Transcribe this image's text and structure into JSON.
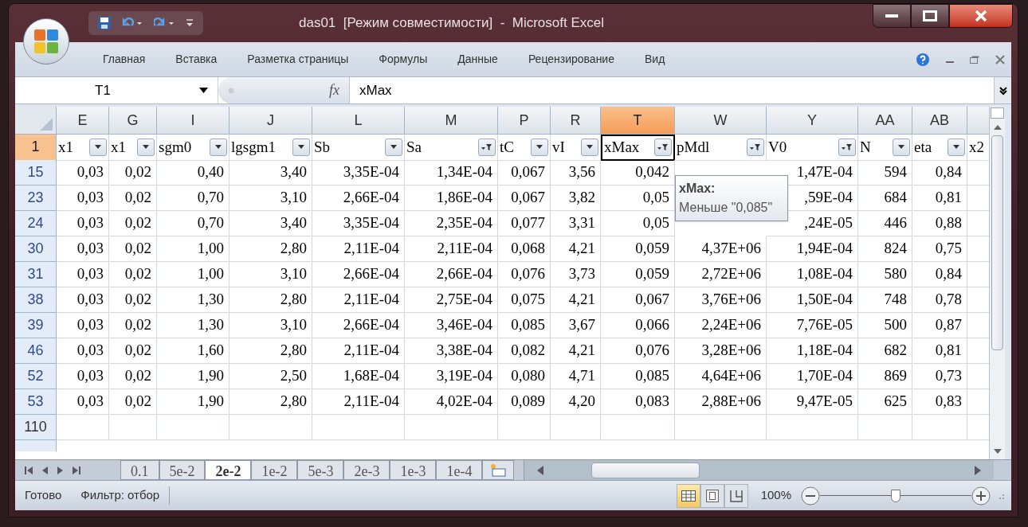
{
  "window": {
    "title": "das01  [Режим совместимости]  -  Microsoft Excel"
  },
  "ribbon_tabs": [
    "Главная",
    "Вставка",
    "Разметка страницы",
    "Формулы",
    "Данные",
    "Рецензирование",
    "Вид"
  ],
  "formula_bar": {
    "name_box": "T1",
    "fx_label": "fx",
    "formula": "xMax"
  },
  "columns": [
    {
      "letter": "E",
      "selected": false
    },
    {
      "letter": "G",
      "selected": false
    },
    {
      "letter": "I",
      "selected": false
    },
    {
      "letter": "J",
      "selected": false
    },
    {
      "letter": "L",
      "selected": false
    },
    {
      "letter": "M",
      "selected": false
    },
    {
      "letter": "P",
      "selected": false
    },
    {
      "letter": "R",
      "selected": false
    },
    {
      "letter": "T",
      "selected": true
    },
    {
      "letter": "W",
      "selected": false
    },
    {
      "letter": "Y",
      "selected": false
    },
    {
      "letter": "AA",
      "selected": false
    },
    {
      "letter": "AB",
      "selected": false
    }
  ],
  "header_row": {
    "number": "1",
    "selected": true,
    "cells": [
      {
        "text": "x1",
        "filtered": false,
        "selected": false
      },
      {
        "text": "x1",
        "filtered": false,
        "selected": false
      },
      {
        "text": "sgm0",
        "filtered": false,
        "selected": false
      },
      {
        "text": "lgsgm1",
        "filtered": false,
        "selected": false
      },
      {
        "text": "Sb",
        "filtered": false,
        "selected": false
      },
      {
        "text": "Sa",
        "filtered": true,
        "selected": false
      },
      {
        "text": "tC",
        "filtered": false,
        "selected": false
      },
      {
        "text": "vI",
        "filtered": false,
        "selected": false
      },
      {
        "text": "xMax",
        "filtered": true,
        "selected": true
      },
      {
        "text": "pMdl",
        "filtered": true,
        "selected": false
      },
      {
        "text": "V0",
        "filtered": true,
        "selected": false
      },
      {
        "text": "N",
        "filtered": false,
        "selected": false
      },
      {
        "text": "eta",
        "filtered": false,
        "selected": false
      }
    ],
    "cut_cell": "x2"
  },
  "rows": [
    {
      "number": "15",
      "cells": [
        "0,03",
        "0,02",
        "0,40",
        "3,40",
        "3,35E-04",
        "1,34E-04",
        "0,067",
        "3,56",
        "0,042",
        null,
        "1,47E-04",
        "594",
        "0,84"
      ]
    },
    {
      "number": "23",
      "cells": [
        "0,03",
        "0,02",
        "0,70",
        "3,10",
        "2,66E-04",
        "1,86E-04",
        "0,067",
        "3,82",
        "0,05",
        null,
        ",59E-04",
        "684",
        "0,81"
      ]
    },
    {
      "number": "24",
      "cells": [
        "0,03",
        "0,02",
        "0,70",
        "3,40",
        "3,35E-04",
        "2,35E-04",
        "0,077",
        "3,31",
        "0,05",
        null,
        ",24E-05",
        "446",
        "0,88"
      ]
    },
    {
      "number": "30",
      "cells": [
        "0,03",
        "0,02",
        "1,00",
        "2,80",
        "2,11E-04",
        "2,11E-04",
        "0,068",
        "4,21",
        "0,059",
        "4,37E+06",
        "1,94E-04",
        "824",
        "0,75"
      ]
    },
    {
      "number": "31",
      "cells": [
        "0,03",
        "0,02",
        "1,00",
        "3,10",
        "2,66E-04",
        "2,66E-04",
        "0,076",
        "3,73",
        "0,059",
        "2,72E+06",
        "1,08E-04",
        "580",
        "0,84"
      ]
    },
    {
      "number": "38",
      "cells": [
        "0,03",
        "0,02",
        "1,30",
        "2,80",
        "2,11E-04",
        "2,75E-04",
        "0,075",
        "4,21",
        "0,067",
        "3,76E+06",
        "1,50E-04",
        "748",
        "0,78"
      ]
    },
    {
      "number": "39",
      "cells": [
        "0,03",
        "0,02",
        "1,30",
        "3,10",
        "2,66E-04",
        "3,46E-04",
        "0,085",
        "3,67",
        "0,066",
        "2,24E+06",
        "7,76E-05",
        "500",
        "0,87"
      ]
    },
    {
      "number": "46",
      "cells": [
        "0,03",
        "0,02",
        "1,60",
        "2,80",
        "2,11E-04",
        "3,38E-04",
        "0,082",
        "4,21",
        "0,076",
        "3,28E+06",
        "1,18E-04",
        "682",
        "0,81"
      ]
    },
    {
      "number": "52",
      "cells": [
        "0,03",
        "0,02",
        "1,90",
        "2,50",
        "1,68E-04",
        "3,19E-04",
        "0,080",
        "4,71",
        "0,085",
        "4,64E+06",
        "1,70E-04",
        "869",
        "0,73"
      ]
    },
    {
      "number": "53",
      "cells": [
        "0,03",
        "0,02",
        "1,90",
        "2,80",
        "2,11E-04",
        "4,02E-04",
        "0,089",
        "4,20",
        "0,083",
        "2,88E+06",
        "9,47E-05",
        "625",
        "0,83"
      ]
    }
  ],
  "empty_rows": [
    "110"
  ],
  "tooltip": {
    "title": "xMax:",
    "text": "Меньше \"0,085\""
  },
  "sheet_tabs": [
    {
      "label": "0.1",
      "selected": false
    },
    {
      "label": "5e-2",
      "selected": false
    },
    {
      "label": "2e-2",
      "selected": true
    },
    {
      "label": "1e-2",
      "selected": false
    },
    {
      "label": "5e-3",
      "selected": false
    },
    {
      "label": "2e-3",
      "selected": false
    },
    {
      "label": "1e-3",
      "selected": false
    },
    {
      "label": "1e-4",
      "selected": false
    }
  ],
  "status_bar": {
    "ready": "Готово",
    "filter": "Фильтр: отбор",
    "views": [
      {
        "kind": "normal",
        "selected": true
      },
      {
        "kind": "layout",
        "selected": false
      },
      {
        "kind": "pagebreak",
        "selected": false
      }
    ],
    "zoom": "100%",
    "zoom_slider": {
      "level": 0.5
    }
  }
}
